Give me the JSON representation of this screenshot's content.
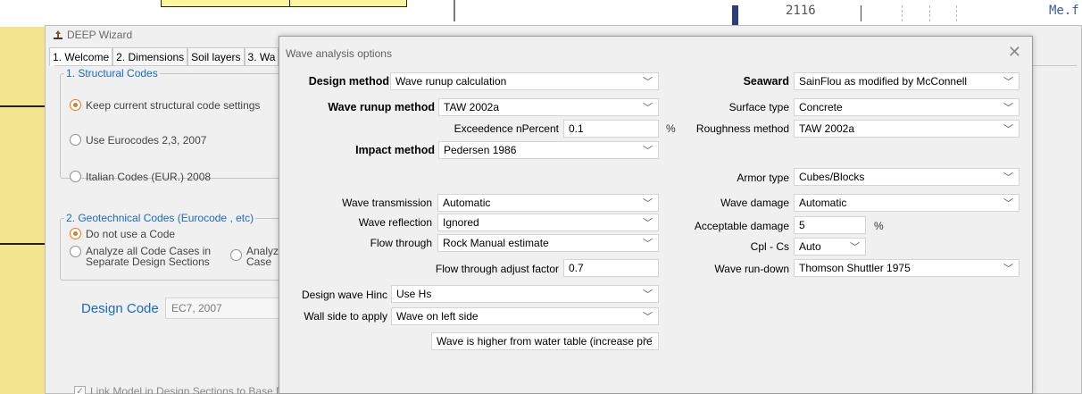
{
  "background": {
    "code_number": "2116",
    "code_fragment": "Me.f"
  },
  "wizard": {
    "title": "DEEP Wizard",
    "tabs": [
      "1. Welcome",
      "2. Dimensions",
      "Soil layers",
      "3. Wa"
    ],
    "structural": {
      "title": "1. Structural Codes",
      "opt1": "Keep current structural code settings",
      "opt2": "Use Eurocodes 2,3, 2007",
      "opt3": "Italian Codes (EUR.) 2008"
    },
    "geotech": {
      "title": "2. Geotechnical Codes (Eurocode , etc)",
      "opt1": "Do not use a Code",
      "opt2": "Analyze all Code Cases in Separate Design Sections",
      "opt3": "Analyze Case"
    },
    "design_code_label": "Design Code",
    "design_code_value": "EC7, 2007",
    "link_model": "Link Model in Design Sections to Base Desi"
  },
  "dialog": {
    "title": "Wave analysis options",
    "close": "✕",
    "design_method": {
      "label": "Design method",
      "value": "Wave runup calculation"
    },
    "wave_runup_method": {
      "label": "Wave runup method",
      "value": "TAW 2002a"
    },
    "exceedence": {
      "label": "Exceedence nPercent",
      "value": "0.1",
      "unit": "%"
    },
    "impact_method": {
      "label": "Impact method",
      "value": "Pedersen 1986"
    },
    "wave_transmission": {
      "label": "Wave transmission",
      "value": "Automatic"
    },
    "wave_reflection": {
      "label": "Wave reflection",
      "value": "Ignored"
    },
    "flow_through": {
      "label": "Flow through",
      "value": "Rock Manual estimate"
    },
    "flow_adjust": {
      "label": "Flow through adjust factor",
      "value": "0.7"
    },
    "design_wave": {
      "label": "Design wave Hinc",
      "value": "Use Hs"
    },
    "wall_side": {
      "label": "Wall side to apply",
      "value": "Wave on left side"
    },
    "wave_higher": {
      "value": "Wave is higher from water table (increase pre"
    },
    "seaward": {
      "label": "Seaward",
      "value": "SainFlou as modified by McConnell"
    },
    "surface_type": {
      "label": "Surface type",
      "value": "Concrete"
    },
    "roughness": {
      "label": "Roughness method",
      "value": "TAW 2002a"
    },
    "armor_type": {
      "label": "Armor type",
      "value": "Cubes/Blocks"
    },
    "wave_damage": {
      "label": "Wave damage",
      "value": "Automatic"
    },
    "acceptable_damage": {
      "label": "Acceptable damage",
      "value": "5",
      "unit": "%"
    },
    "cpl_cs": {
      "label": "Cpl - Cs",
      "value": "Auto"
    },
    "wave_rundown": {
      "label": "Wave run-down",
      "value": "Thomson Shuttler 1975"
    }
  }
}
